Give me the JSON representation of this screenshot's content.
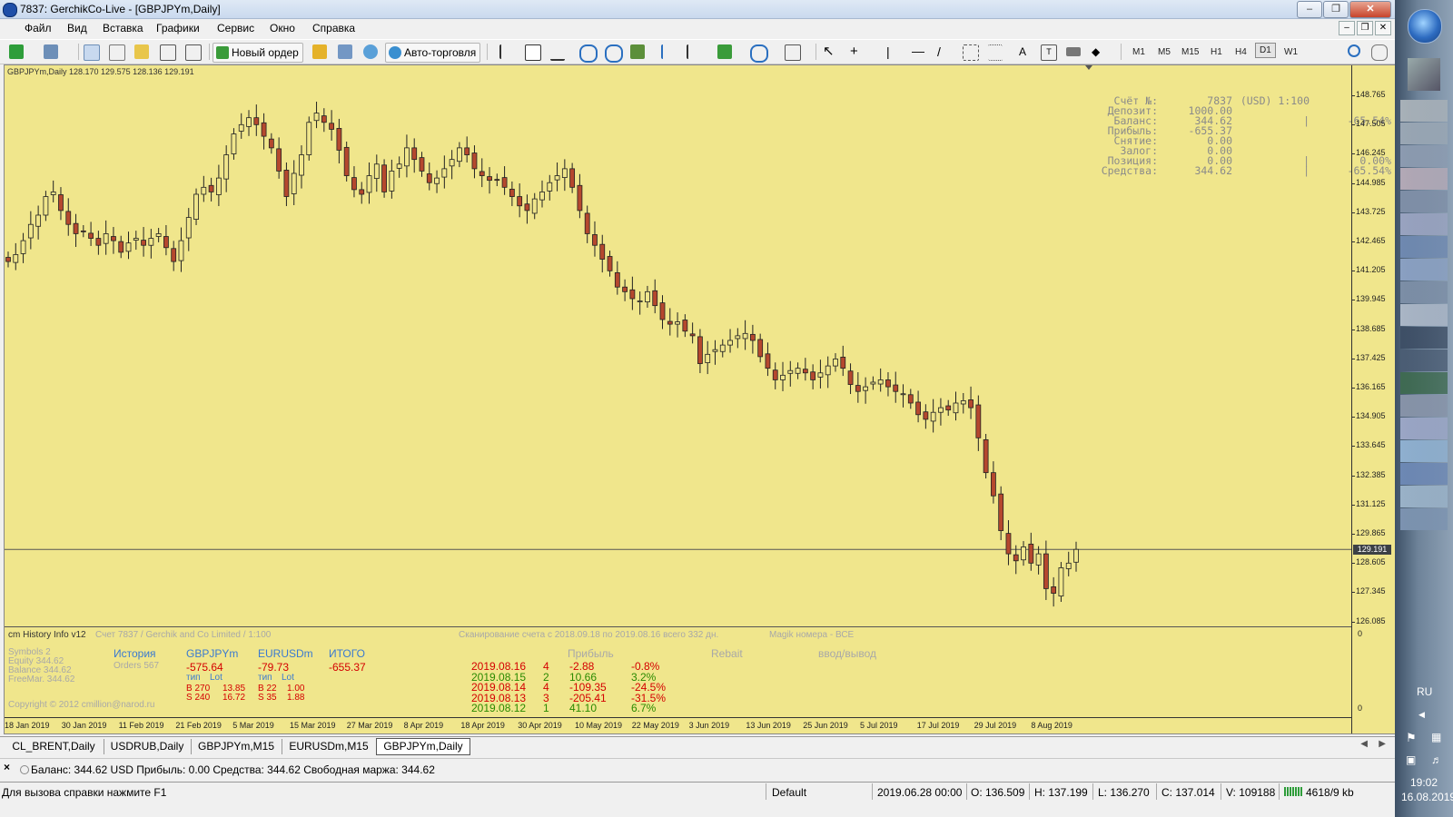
{
  "window": {
    "title": "7837: GerchikCo-Live - [GBPJPYm,Daily]"
  },
  "menu": [
    "Файл",
    "Вид",
    "Вставка",
    "Графики",
    "Сервис",
    "Окно",
    "Справка"
  ],
  "toolbar": {
    "new_order": "Новый ордер",
    "auto_trading": "Авто-торговля",
    "timeframes": [
      "M1",
      "M5",
      "M15",
      "H1",
      "H4",
      "D1",
      "W1"
    ],
    "active_timeframe": "D1"
  },
  "chart": {
    "header": "GBPJPYm,Daily  128.170 129.575 128.136 129.191",
    "current_price": "129.191",
    "price_ticks": [
      "148.765",
      "147.505",
      "146.245",
      "144.985",
      "143.725",
      "142.465",
      "141.205",
      "139.945",
      "138.685",
      "137.425",
      "136.165",
      "134.905",
      "133.645",
      "132.385",
      "131.125",
      "129.865",
      "128.605",
      "127.345",
      "126.085"
    ],
    "date_ticks": [
      "18 Jan 2019",
      "30 Jan 2019",
      "11 Feb 2019",
      "21 Feb 2019",
      "5 Mar 2019",
      "15 Mar 2019",
      "27 Mar 2019",
      "8 Apr 2019",
      "18 Apr 2019",
      "30 Apr 2019",
      "10 May 2019",
      "22 May 2019",
      "3 Jun 2019",
      "13 Jun 2019",
      "25 Jun 2019",
      "5 Jul 2019",
      "17 Jul 2019",
      "29 Jul 2019",
      "8 Aug 2019"
    ],
    "up_color": "#f0e68c",
    "down_color": "#b5482e"
  },
  "chart_data": {
    "type": "candlestick",
    "symbol": "GBPJPYm",
    "timeframe": "Daily",
    "ylim": [
      126.085,
      148.765
    ],
    "ohlc_latest": {
      "open": 128.17,
      "high": 129.575,
      "low": 128.136,
      "close": 129.191
    },
    "close_path": [
      141.6,
      141.9,
      142.5,
      143.2,
      143.6,
      144.4,
      144.6,
      143.8,
      143.2,
      142.8,
      142.9,
      142.6,
      142.3,
      142.8,
      142.5,
      142.0,
      142.4,
      142.6,
      142.3,
      142.6,
      142.8,
      142.2,
      141.6,
      142.5,
      143.5,
      144.5,
      144.8,
      144.6,
      145.2,
      146.2,
      147.1,
      147.5,
      147.8,
      147.5,
      147.0,
      146.5,
      145.5,
      144.4,
      145.4,
      146.2,
      147.6,
      148.0,
      147.6,
      147.3,
      146.4,
      145.3,
      144.7,
      144.5,
      145.3,
      145.8,
      144.6,
      145.5,
      145.8,
      146.5,
      146.0,
      145.5,
      145.0,
      145.2,
      145.6,
      146.0,
      146.5,
      146.2,
      145.6,
      145.3,
      145.1,
      145.1,
      144.8,
      144.4,
      144.0,
      143.8,
      144.3,
      144.6,
      145.0,
      145.3,
      145.6,
      144.8,
      143.8,
      142.8,
      142.3,
      141.7,
      141.2,
      140.5,
      140.3,
      140.0,
      139.9,
      140.3,
      139.7,
      139.1,
      138.9,
      139.0,
      138.6,
      138.4,
      137.2,
      137.6,
      137.8,
      138.0,
      138.2,
      138.4,
      138.5,
      138.2,
      137.5,
      137.0,
      136.5,
      136.7,
      136.9,
      137.0,
      136.8,
      136.5,
      136.8,
      137.1,
      137.4,
      137.0,
      136.3,
      136.0,
      136.2,
      136.4,
      136.5,
      136.2,
      136.0,
      135.9,
      135.5,
      135.0,
      134.8,
      135.1,
      135.3,
      135.2,
      135.5,
      135.6,
      135.3,
      134.0,
      132.5,
      131.5,
      130.0,
      129.0,
      128.7,
      129.3,
      128.6,
      129.0,
      127.5,
      127.3,
      128.4,
      128.6,
      129.191
    ]
  },
  "account_panel": [
    {
      "label": "Счёт №:",
      "v1": "7837",
      "v2": "(USD) 1:100",
      "v3": ""
    },
    {
      "label": "Депозит:",
      "v1": "1000.00",
      "v2": "",
      "v3": ""
    },
    {
      "label": "Баланс:",
      "v1": "344.62",
      "v2": "|",
      "v3": "-65.54%"
    },
    {
      "label": "Прибыль:",
      "v1": "-655.37",
      "v2": "",
      "v3": ""
    },
    {
      "label": "Снятие:",
      "v1": "0.00",
      "v2": "",
      "v3": ""
    },
    {
      "label": "Залог:",
      "v1": "0.00",
      "v2": "",
      "v3": ""
    },
    {
      "label": "Позиция:",
      "v1": "0.00",
      "v2": "|",
      "v3": "0.00%"
    },
    {
      "label": "Средства:",
      "v1": "344.62",
      "v2": "|",
      "v3": "-65.54%"
    }
  ],
  "indicator": {
    "name": "cm History Info v12",
    "account_line": "Счет 7837 / Gerchik and Co Limited / 1:100",
    "scan_line": "Сканирование счета с 2018.09.18 по 2019.08.16 всего 332 дн.",
    "magic_line": "Magik номера - ВСЕ",
    "zero_top": "0",
    "zero_bottom": "0",
    "stats": {
      "symbols": "Symbols  2",
      "equity": "Equity    344.62",
      "balance": "Balance   344.62",
      "freemar": "FreeMar.  344.62"
    },
    "history": {
      "title": "История",
      "orders": "Orders 567"
    },
    "gbp": {
      "name": "GBPJPYm",
      "profit": "-575.64",
      "hdr_type": "тип",
      "hdr_lot": "Lot",
      "buy": "B 270",
      "buy_lot": "13.85",
      "sell": "S 240",
      "sell_lot": "16.72"
    },
    "eur": {
      "name": "EURUSDm",
      "profit": "-79.73",
      "hdr_type": "тип",
      "hdr_lot": "Lot",
      "buy": "B 22",
      "buy_lot": "1.00",
      "sell": "S 35",
      "sell_lot": "1.88"
    },
    "total": {
      "title": "ИТОГО",
      "value": "-655.37"
    },
    "headers": {
      "profit": "Прибыль",
      "rebate": "Rebait",
      "inout": "ввод/вывод"
    },
    "daily": [
      {
        "date": "2019.08.16",
        "n": "4",
        "profit": "-2.88",
        "pct": "-0.8%",
        "color": "#d40000"
      },
      {
        "date": "2019.08.15",
        "n": "2",
        "profit": "10.66",
        "pct": "3.2%",
        "color": "#2a8a00"
      },
      {
        "date": "2019.08.14",
        "n": "4",
        "profit": "-109.35",
        "pct": "-24.5%",
        "color": "#d40000"
      },
      {
        "date": "2019.08.13",
        "n": "3",
        "profit": "-205.41",
        "pct": "-31.5%",
        "color": "#d40000"
      },
      {
        "date": "2019.08.12",
        "n": "1",
        "profit": "41.10",
        "pct": "6.7%",
        "color": "#2a8a00"
      }
    ],
    "copyright": "Copyright © 2012 cmillion@narod.ru"
  },
  "tabs": [
    "CL_BRENT,Daily",
    "USDRUB,Daily",
    "GBPJPYm,M15",
    "EURUSDm,M15",
    "GBPJPYm,Daily"
  ],
  "active_tab": "GBPJPYm,Daily",
  "terminal": {
    "text": "Баланс: 344.62 USD  Прибыль: 0.00  Средства: 344.62  Свободная маржа: 344.62"
  },
  "status": {
    "help": "Для вызова справки нажмите F1",
    "profile": "Default",
    "datetime": "2019.06.28 00:00",
    "open": "O: 136.509",
    "high": "H: 137.199",
    "low": "L: 136.270",
    "close": "C: 137.014",
    "volume": "V: 109188",
    "traffic": "4618/9 kb"
  },
  "taskbar": {
    "lang": "RU",
    "time": "19:02",
    "date": "16.08.2019"
  }
}
